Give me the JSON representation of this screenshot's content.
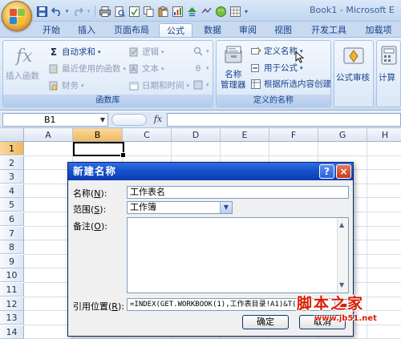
{
  "window": {
    "title": "Book1 - Microsoft E"
  },
  "quick_access": [
    "save-icon",
    "undo-icon",
    "redo-icon",
    "print-icon",
    "print-preview-icon",
    "spelling-icon",
    "copy-icon",
    "paste-icon",
    "format-painter-icon",
    "sort-icon",
    "record-icon",
    "chart-icon",
    "customize-icon"
  ],
  "tabs": [
    {
      "label": "开始",
      "active": false
    },
    {
      "label": "插入",
      "active": false
    },
    {
      "label": "页面布局",
      "active": false
    },
    {
      "label": "公式",
      "active": true
    },
    {
      "label": "数据",
      "active": false
    },
    {
      "label": "审阅",
      "active": false
    },
    {
      "label": "视图",
      "active": false
    },
    {
      "label": "开发工具",
      "active": false
    },
    {
      "label": "加载项",
      "active": false
    }
  ],
  "ribbon": {
    "function_library": {
      "group_label": "函数库",
      "insert_function": "插入函数",
      "autosum": "自动求和",
      "recently_used": "最近使用的函数",
      "financial": "财务",
      "logical": "逻辑",
      "text": "文本",
      "date_time": "日期和时间"
    },
    "defined_names": {
      "group_label": "定义的名称",
      "name_manager": "名称\n管理器",
      "name_manager_l1": "名称",
      "name_manager_l2": "管理器",
      "define_name": "定义名称",
      "use_in_formula": "用于公式",
      "create_from_selection": "根据所选内容创建"
    },
    "formula_auditing": "公式审核",
    "calculation": "计算"
  },
  "formula_bar": {
    "name_box": "B1",
    "fx": "fx",
    "formula": ""
  },
  "sheet": {
    "columns": [
      "A",
      "B",
      "C",
      "D",
      "E",
      "F",
      "G",
      "H"
    ],
    "rows": [
      "1",
      "2",
      "3",
      "4",
      "5",
      "6",
      "7",
      "8",
      "9",
      "10",
      "11",
      "12",
      "13",
      "14"
    ],
    "selected_column": "B",
    "selected_row": "1"
  },
  "dialog": {
    "title": "新建名称",
    "help": "?",
    "close": "×",
    "name_label": "名称",
    "name_key": "N",
    "name_value": "工作表名",
    "scope_label": "范围",
    "scope_key": "S",
    "scope_value": "工作簿",
    "comment_label": "备注",
    "comment_key": "O",
    "comment_value": "",
    "refers_label": "引用位置",
    "refers_key": "R",
    "refers_value": "=INDEX(GET.WORKBOOK(1),工作表目录!A1)&T(",
    "ok": "确定",
    "cancel": "取消"
  },
  "watermark": {
    "main": "脚本之家",
    "url": "www.jb51.net"
  },
  "colors": {
    "ribbon_text": "#15428b",
    "dialog_title": "#1752cc",
    "selection": "#f1b95b",
    "watermark": "#d81e06"
  }
}
